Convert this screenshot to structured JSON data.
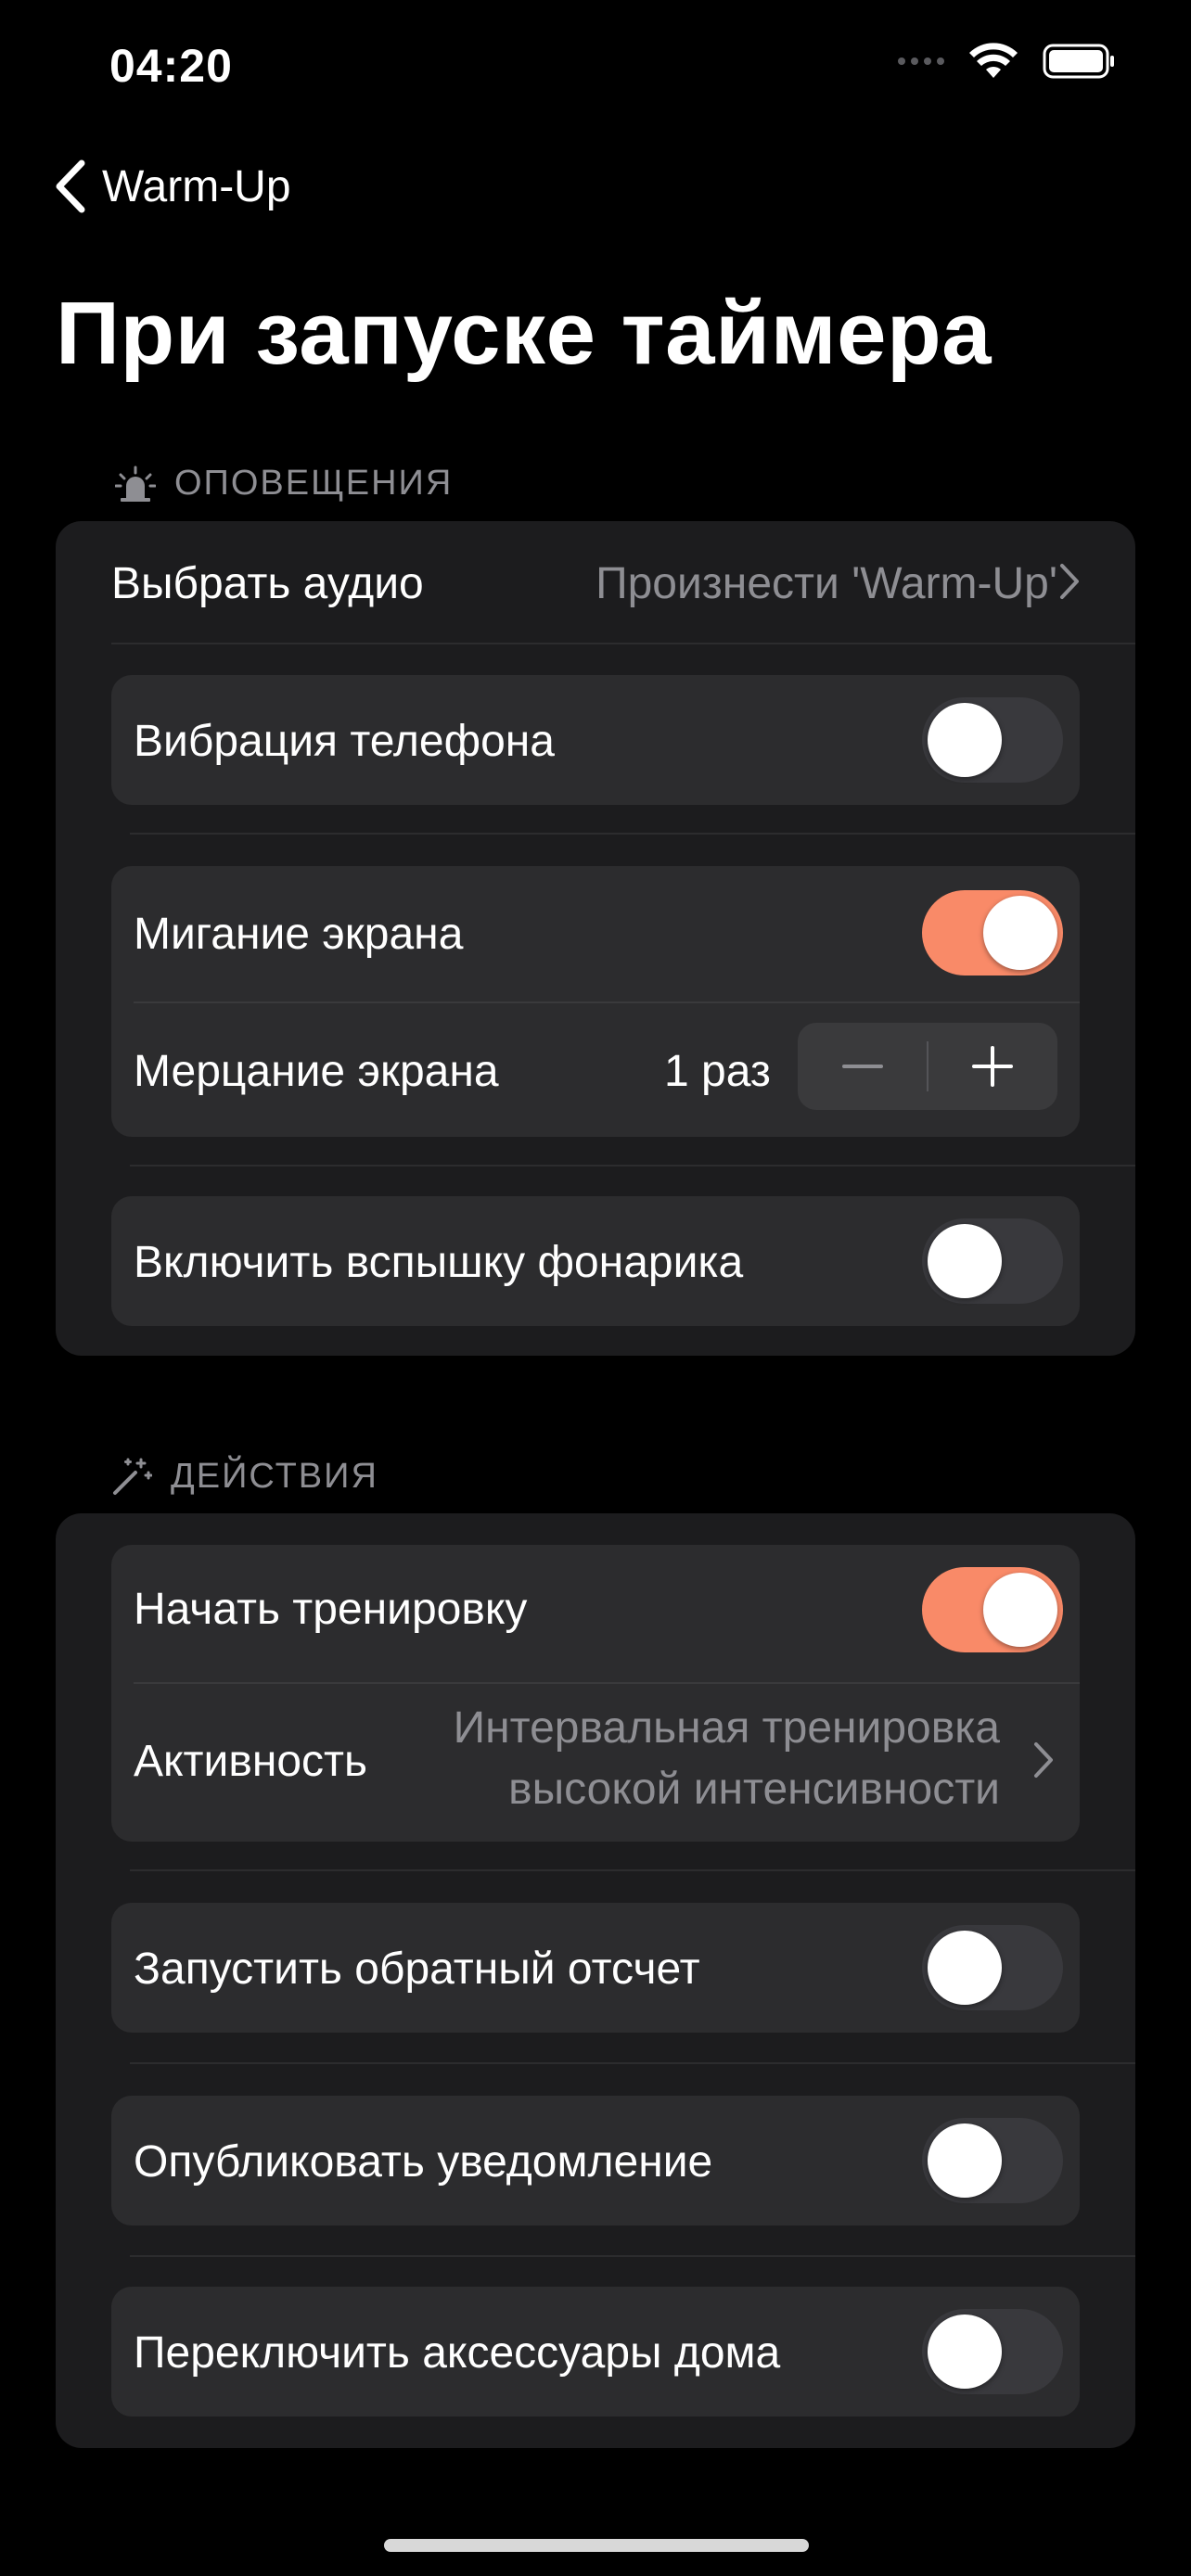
{
  "status_bar": {
    "time": "04:20"
  },
  "nav": {
    "back_label": "Warm-Up"
  },
  "page_title": "При запуске таймера",
  "notifications": {
    "header": "ОПОВЕЩЕНИЯ",
    "audio": {
      "label": "Выбрать аудио",
      "value": "Произнести 'Warm-Up'"
    },
    "vibration": {
      "label": "Вибрация телефона",
      "on": false
    },
    "screen_flash": {
      "label": "Мигание экрана",
      "on": true
    },
    "screen_flicker": {
      "label": "Мерцание экрана",
      "value": "1 раз",
      "minus": "−",
      "plus": "+"
    },
    "flashlight": {
      "label": "Включить вспышку фонарика",
      "on": false
    }
  },
  "actions": {
    "header": "ДЕЙСТВИЯ",
    "start_workout": {
      "label": "Начать тренировку",
      "on": true
    },
    "activity": {
      "label": "Активность",
      "value_line1": "Интервальная тренировка",
      "value_line2": "высокой интенсивности"
    },
    "countdown": {
      "label": "Запустить обратный отсчет",
      "on": false
    },
    "notification": {
      "label": "Опубликовать уведомление",
      "on": false
    },
    "home_accessories": {
      "label": "Переключить аксессуары дома",
      "on": false
    }
  },
  "colors": {
    "accent": "#f98a68",
    "background": "#000000",
    "card": "#1c1c1e",
    "inner_card": "#2c2c2e",
    "secondary_text": "#8e8e93"
  },
  "icons": {
    "signal": "cellular-dots-icon",
    "wifi": "wifi-icon",
    "battery": "battery-icon",
    "back": "chevron-left-icon",
    "notifications": "siren-icon",
    "actions": "magic-wand-icon",
    "disclosure": "chevron-right-icon"
  }
}
